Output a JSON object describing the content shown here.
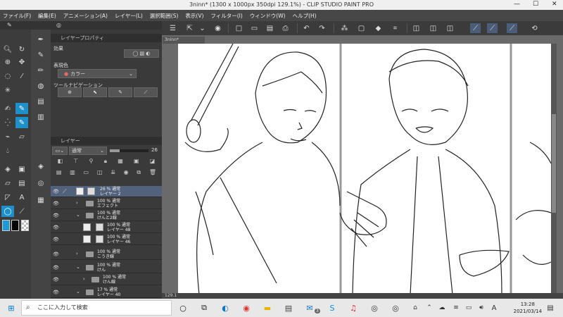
{
  "window": {
    "title": "3ninn* (1300 x 1000px 350dpi 129.1%) - CLIP STUDIO PAINT PRO",
    "minimize": "—",
    "maximize": "☐",
    "close": "✕"
  },
  "menu": [
    "ファイル(F)",
    "編集(E)",
    "アニメーション(A)",
    "レイヤー(L)",
    "選択範囲(S)",
    "表示(V)",
    "フィルター(I)",
    "ウィンドウ(W)",
    "ヘルプ(H)"
  ],
  "tab": {
    "label": "3ninn*"
  },
  "property_panel": {
    "header": "レイヤープロパティ",
    "effect_label": "効果",
    "express_color_label": "表現色",
    "express_color_value": "カラー",
    "tool_nav_label": "ツールナビゲーション"
  },
  "layer_panel": {
    "header": "レイヤー",
    "blend_mode": "通常",
    "opacity": "26",
    "layers": [
      {
        "name": "26 % 通常\nレイヤー 2",
        "kind": "raster",
        "selected": true
      },
      {
        "name": "100 % 通常\nエフェクト",
        "kind": "folder",
        "selected": false
      },
      {
        "name": "100 % 通常\nけんと2線",
        "kind": "folder",
        "selected": false
      },
      {
        "name": "100 % 通常\nレイヤー 48",
        "kind": "raster",
        "selected": false
      },
      {
        "name": "100 % 通常\nレイヤー 46",
        "kind": "raster",
        "selected": false
      },
      {
        "name": "100 % 通常\nこうき線",
        "kind": "folder",
        "selected": false
      },
      {
        "name": "100 % 通常\nけん",
        "kind": "folder",
        "selected": false
      },
      {
        "name": "100 % 通常\nけん線",
        "kind": "folder",
        "selected": false
      },
      {
        "name": "17 % 通常\nレイヤー 40",
        "kind": "folder",
        "selected": false
      }
    ]
  },
  "status": {
    "zoom": "129.1"
  },
  "taskbar": {
    "search_placeholder": "ここに入力して検索",
    "time": "13:28",
    "date": "2021/03/14",
    "ime": "A",
    "badge": "3"
  },
  "colors": {
    "accent": "#1e8fc9",
    "selected_layer": "#52627c",
    "main_color": "#1e9ad6",
    "sub_color": "#000000"
  }
}
